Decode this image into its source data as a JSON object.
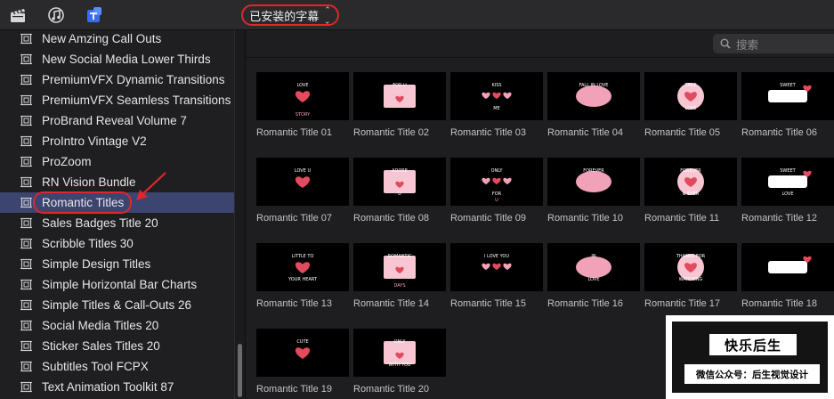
{
  "toolbar": {
    "icons": [
      "clapper-icon",
      "music-icon",
      "titles-icon"
    ],
    "dropdown_label": "已安装的字幕",
    "accent_color": "#e0262b"
  },
  "sidebar": {
    "items": [
      {
        "label": "New Amzing Call Outs"
      },
      {
        "label": "New Social Media Lower Thirds"
      },
      {
        "label": "PremiumVFX Dynamic Transitions"
      },
      {
        "label": "PremiumVFX Seamless Transitions"
      },
      {
        "label": "ProBrand Reveal Volume 7"
      },
      {
        "label": "ProIntro Vintage V2"
      },
      {
        "label": "ProZoom"
      },
      {
        "label": "RN Vision Bundle"
      },
      {
        "label": "Romantic Titles",
        "selected": true
      },
      {
        "label": "Sales Badges Title 20"
      },
      {
        "label": "Scribble Titles 30"
      },
      {
        "label": "Simple Design Titles"
      },
      {
        "label": "Simple Horizontal Bar Charts"
      },
      {
        "label": "Simple Titles & Call-Outs 26"
      },
      {
        "label": "Social Media Titles 20"
      },
      {
        "label": "Sticker Sales Titles 20"
      },
      {
        "label": "Subtitles Tool FCPX"
      },
      {
        "label": "Text Animation Toolkit 87"
      }
    ],
    "selection_color": "#3c4470"
  },
  "search": {
    "placeholder": "搜索"
  },
  "tiles": [
    {
      "label": "Romantic Title 01",
      "art": [
        "LOVE",
        "",
        "STORY"
      ]
    },
    {
      "label": "Romantic Title 02",
      "art": [
        "FOR U",
        "",
        ""
      ]
    },
    {
      "label": "Romantic Title 03",
      "art": [
        "KISS",
        "ME",
        ""
      ]
    },
    {
      "label": "Romantic Title 04",
      "art": [
        "FALL IN LOVE",
        "",
        ""
      ]
    },
    {
      "label": "Romantic Title 05",
      "art": [
        "TRUE",
        "LOVE",
        ""
      ]
    },
    {
      "label": "Romantic Title 06",
      "art": [
        "SWEET",
        "",
        ""
      ]
    },
    {
      "label": "Romantic Title 07",
      "art": [
        "LOVE U",
        "",
        ""
      ]
    },
    {
      "label": "Romantic Title 08",
      "art": [
        "ADORE",
        "U",
        ""
      ]
    },
    {
      "label": "Romantic Title 09",
      "art": [
        "ONLY",
        "FOR",
        "U"
      ]
    },
    {
      "label": "Romantic Title 10",
      "art": [
        "FOREVER",
        "",
        ""
      ]
    },
    {
      "label": "Romantic Title 11",
      "art": [
        "FOREVER",
        "& EVER",
        ""
      ]
    },
    {
      "label": "Romantic Title 12",
      "art": [
        "SWEET",
        "LOVE",
        ""
      ]
    },
    {
      "label": "Romantic Title 13",
      "art": [
        "LITTLE TO",
        "YOUR HEART",
        ""
      ]
    },
    {
      "label": "Romantic Title 14",
      "art": [
        "ROMANTIC",
        "",
        "DAYS"
      ]
    },
    {
      "label": "Romantic Title 15",
      "art": [
        "I LOVE YOU",
        "",
        ""
      ]
    },
    {
      "label": "Romantic Title 16",
      "art": [
        "IN",
        "LOVE",
        ""
      ]
    },
    {
      "label": "Romantic Title 17",
      "art": [
        "THANKS FOR",
        "WATCHING",
        ""
      ]
    },
    {
      "label": "Romantic Title 18",
      "art": [
        "",
        "",
        ""
      ]
    },
    {
      "label": "Romantic Title 19",
      "art": [
        "CUTE",
        "",
        ""
      ]
    },
    {
      "label": "Romantic Title 20",
      "art": [
        "ONLY",
        "WITH YOU",
        ""
      ]
    }
  ],
  "watermark": {
    "title": "快乐后生",
    "subtitle": "微信公众号：后生视觉设计"
  }
}
